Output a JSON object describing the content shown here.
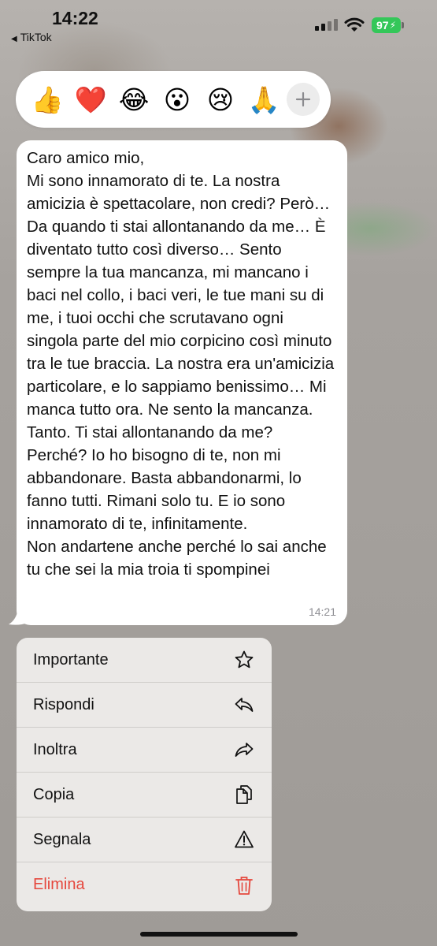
{
  "status_bar": {
    "time": "14:22",
    "back_app": "TikTok",
    "battery": "97"
  },
  "reactions": [
    {
      "emoji": "👍",
      "name": "thumbs-up"
    },
    {
      "emoji": "❤️",
      "name": "heart"
    },
    {
      "emoji": "😂",
      "name": "laughing"
    },
    {
      "emoji": "😮",
      "name": "surprised"
    },
    {
      "emoji": "😢",
      "name": "crying"
    },
    {
      "emoji": "🙏",
      "name": "praying-hands"
    }
  ],
  "message": {
    "text": "Caro amico mio,\nMi sono innamorato di te. La nostra amicizia è spettacolare, non credi? Però… Da quando ti stai allontanando da me… È diventato tutto così diverso… Sento sempre la tua mancanza, mi mancano i baci nel collo, i baci veri, le tue mani su di me, i tuoi occhi che scrutavano ogni singola parte del mio corpicino così minuto tra le tue braccia. La nostra era un'amicizia particolare, e lo sappiamo benissimo… Mi manca tutto ora. Ne sento la mancanza. Tanto. Ti stai allontanando da me? Perché? Io ho bisogno di te, non mi abbandonare. Basta abbandonarmi, lo fanno tutti. Rimani solo tu. E io sono innamorato di te, infinitamente.\nNon andartene anche perché lo sai anche tu che sei la mia troia ti spompinei",
    "time": "14:21"
  },
  "menu": {
    "star": "Importante",
    "reply": "Rispondi",
    "forward": "Inoltra",
    "copy": "Copia",
    "report": "Segnala",
    "delete": "Elimina"
  },
  "colors": {
    "battery": "#34c759",
    "danger": "#e5483e",
    "bubble": "#ffffff"
  }
}
